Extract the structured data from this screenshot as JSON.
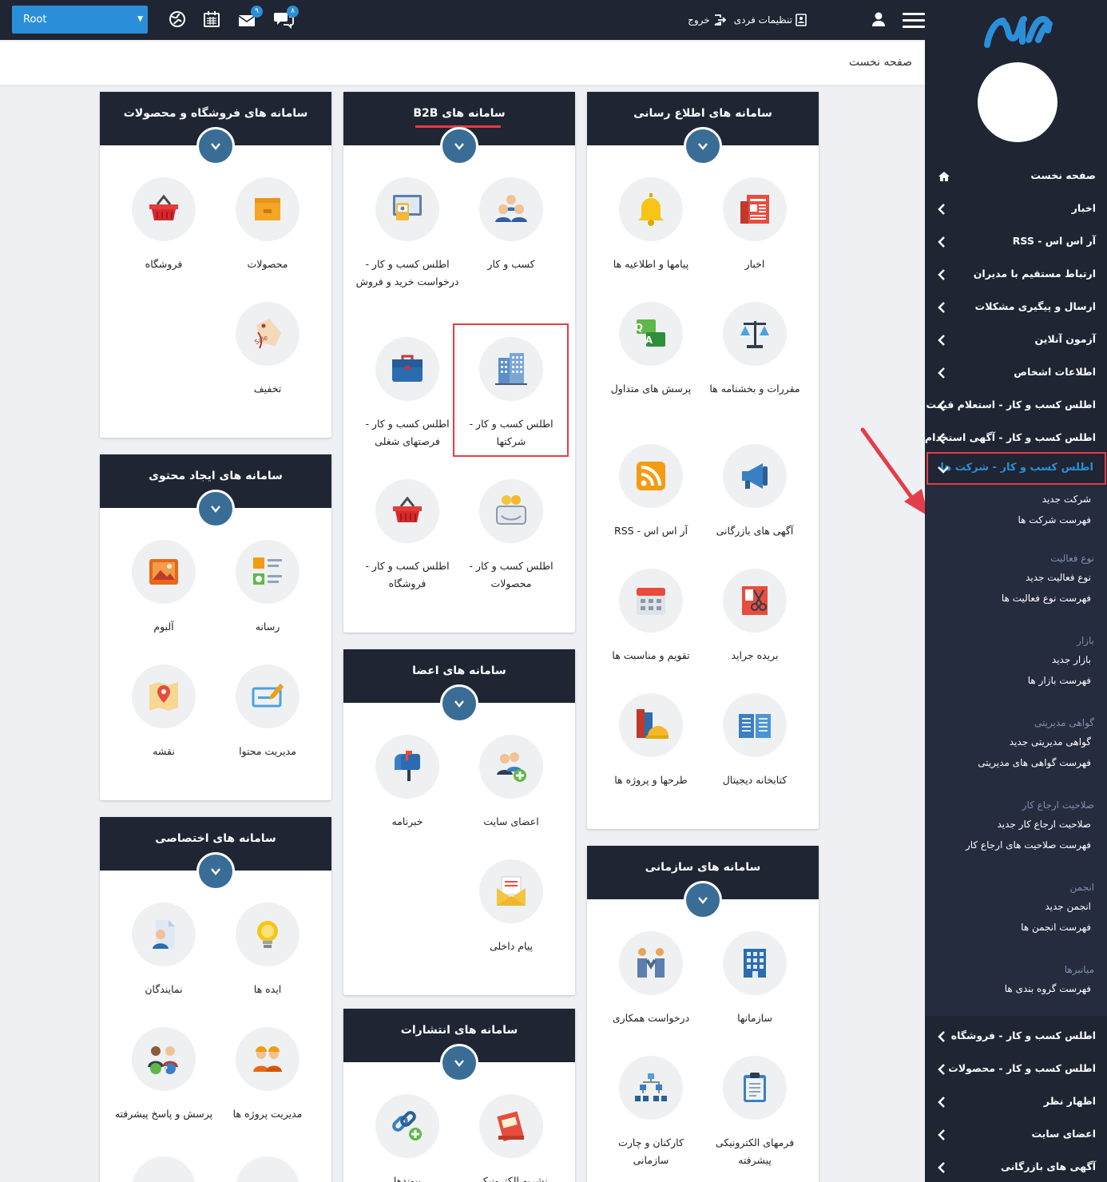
{
  "topbar": {
    "root_select": "Root",
    "mail_badge": "۹",
    "chat_badge": "۸",
    "settings_label": "تنظیمات فردی",
    "logout_label": "خروج"
  },
  "breadcrumb": "صفحه نخست",
  "cards": {
    "shop": {
      "title": "سامانه های فروشگاه و محصولات",
      "items": [
        "محصولات",
        "فروشگاه",
        "تخفیف"
      ]
    },
    "b2b": {
      "title": "سامانه های B2B",
      "items": [
        "کسب و کار",
        "اطلس کسب و کار - درخواست خرید و فروش",
        "اطلس کسب و کار - شرکتها",
        "اطلس کسب و کار - فرصتهای شغلی",
        "اطلس کسب و کار - محصولات",
        "اطلس کسب و کار - فروشگاه"
      ]
    },
    "info": {
      "title": "سامانه های اطلاع رسانی",
      "items": [
        "اخبار",
        "پیامها و اطلاعیه ها",
        "مقررات و بخشنامه ها",
        "پرسش های متداول",
        "آگهی های بازرگانی",
        "آر اس اس - RSS",
        "بریده جراید",
        "تقویم و مناسبت ها",
        "کتابخانه دیجیتال",
        "طرحها و پروژه ها"
      ]
    },
    "content": {
      "title": "سامانه های ایجاد محتوی",
      "items": [
        "رسانه",
        "آلبوم",
        "مدیریت محتوا",
        "نقشه"
      ]
    },
    "members": {
      "title": "سامانه های اعضا",
      "items": [
        "اعضای سایت",
        "خبرنامه",
        "پیام داخلی"
      ]
    },
    "custom": {
      "title": "سامانه های اختصاصی",
      "items": [
        "ایده ها",
        "نمایندگان",
        "مدیریت پروژه ها",
        "پرسش و پاسخ پیشرفته"
      ]
    },
    "org": {
      "title": "سامانه های سازمانی",
      "items": [
        "سازمانها",
        "درخواست همکاری",
        "فرمهای الکترونیکی پیشرفته",
        "کارکنان و چارت سازمانی"
      ]
    },
    "pub": {
      "title": "سامانه های انتشارات",
      "items": [
        "نشریه الکترونیکی",
        "پیوندها"
      ]
    }
  },
  "sidebar": {
    "items": [
      "صفحه نخست",
      "اخبار",
      "آر اس اس - RSS",
      "ارتباط مستقیم با مدیران",
      "ارسال و پیگیری مشکلات",
      "آزمون آنلاین",
      "اطلاعات اشخاص",
      "اطلس کسب و کار - استعلام قیمت",
      "اطلس کسب و کار - آگهی استخدام",
      "اطلس کسب و کار - شرکت ها"
    ],
    "sub": {
      "companies": [
        "شرکت جدید",
        "فهرست شرکت ها"
      ],
      "activity": {
        "title": "نوع فعالیت",
        "links": [
          "نوع فعالیت جدید",
          "فهرست نوع فعالیت ها"
        ]
      },
      "market": {
        "title": "بازار",
        "links": [
          "بازار جدید",
          "فهرست بازار ها"
        ]
      },
      "cert": {
        "title": "گواهی مدیریتی",
        "links": [
          "گواهی مدیریتی جدید",
          "فهرست گواهی های مدیریتی"
        ]
      },
      "referral": {
        "title": "صلاحیت ارجاع کار",
        "links": [
          "صلاحیت ارجاع کار جدید",
          "فهرست صلاحیت های ارجاع کار"
        ]
      },
      "assoc": {
        "title": "انجمن",
        "links": [
          "انجمن جدید",
          "فهرست انجمن ها"
        ]
      },
      "shortcuts": {
        "title": "میانبرها",
        "links": [
          "فهرست گروه بندی ها"
        ]
      }
    },
    "bottom": [
      "اطلس کسب و کار - فروشگاه",
      "اطلس کسب و کار - محصولات",
      "اظهار نظر",
      "اعضای سایت",
      "آگهی های بازرگانی"
    ]
  },
  "colors": {
    "dark": "#1f2533",
    "accent": "#2a8fd8",
    "chevron": "#3a6d96",
    "highlight": "#e43d4a"
  }
}
